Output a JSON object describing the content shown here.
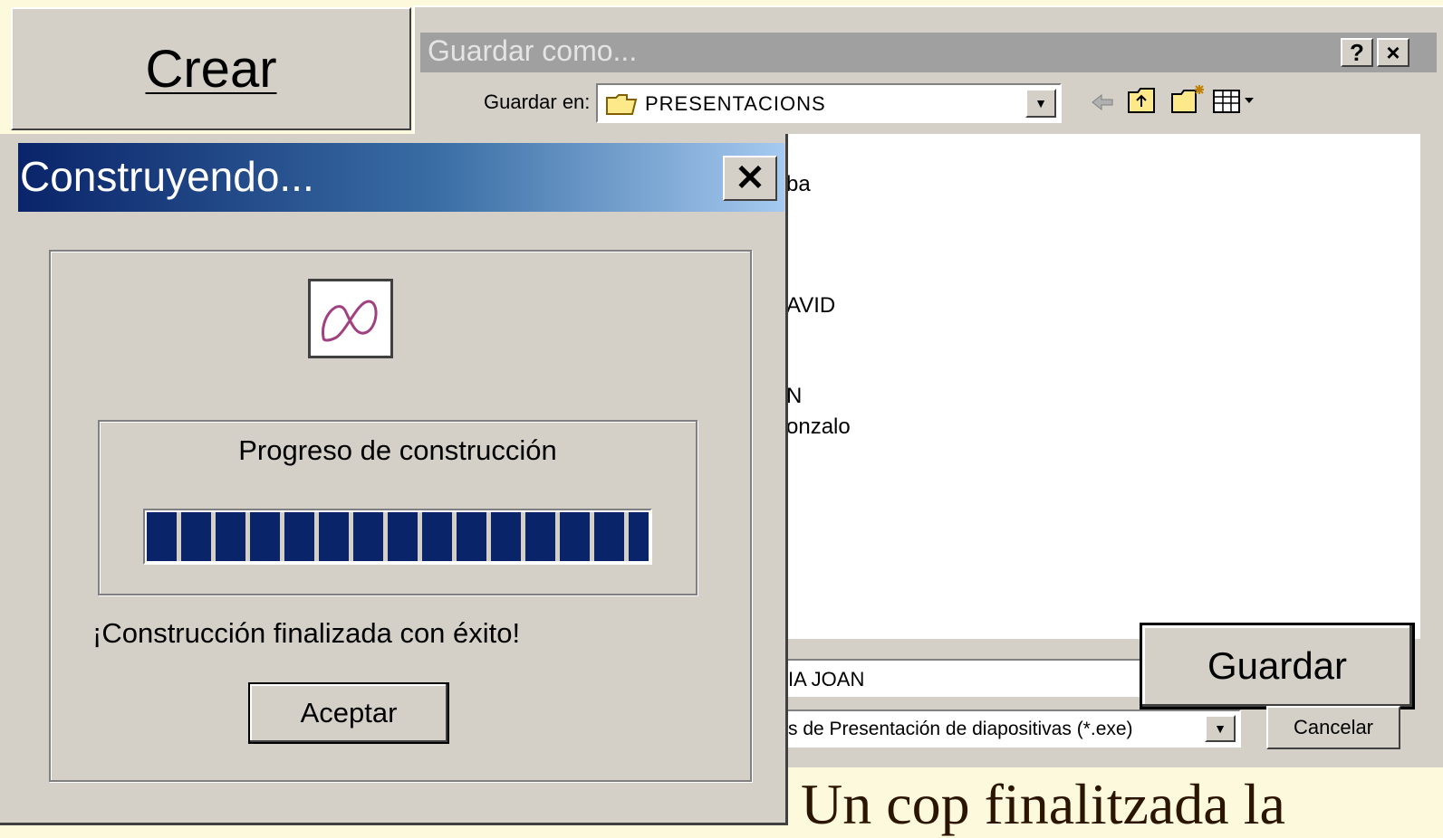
{
  "crear_button": {
    "label": "Crear"
  },
  "save_dialog": {
    "title": "Guardar como...",
    "help_label": "?",
    "close_label": "×",
    "save_in_label": "Guardar en:",
    "folder": "PRESENTACIONS",
    "files": [
      "ba",
      "AVID",
      "N",
      "onzalo"
    ],
    "filename_value": "IA JOAN",
    "filetype_value": "s de Presentación de diapositivas (*.exe)",
    "save_button": "Guardar",
    "cancel_button": "Cancelar",
    "toolbar_icons": [
      "back-arrow-icon",
      "up-folder-icon",
      "new-folder-icon",
      "view-menu-icon"
    ]
  },
  "build_dialog": {
    "title": "Construyendo...",
    "close_label": "✕",
    "progress_label": "Progreso de construcción",
    "progress_fraction": 1.0,
    "status": "¡Construcción finalizada con éxito!",
    "accept_button": "Aceptar"
  },
  "caption": "Un cop finalitzada la",
  "colors": {
    "title_blue": "#0a246a",
    "progress": "#0a246a",
    "dialog_gray": "#d4d0c8",
    "slide_bg": "#fdf9dc"
  }
}
